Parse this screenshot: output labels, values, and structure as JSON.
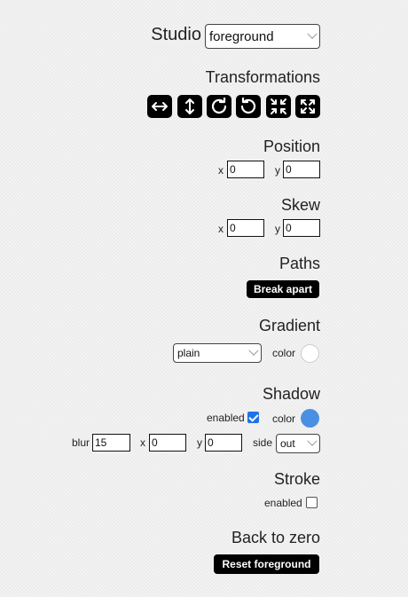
{
  "studio": {
    "title": "Studio",
    "layer_value": "foreground",
    "layer_options": [
      "foreground"
    ]
  },
  "transformations": {
    "title": "Transformations",
    "tools": [
      {
        "name": "flip-horizontal",
        "icon": "arrows-horizontal-icon"
      },
      {
        "name": "flip-vertical",
        "icon": "arrows-vertical-icon"
      },
      {
        "name": "rotate-clockwise",
        "icon": "rotate-cw-icon"
      },
      {
        "name": "rotate-counterclockwise",
        "icon": "rotate-ccw-icon"
      },
      {
        "name": "shrink",
        "icon": "collapse-icon"
      },
      {
        "name": "expand",
        "icon": "expand-icon"
      }
    ]
  },
  "position": {
    "title": "Position",
    "x_label": "x",
    "x_value": "0",
    "y_label": "y",
    "y_value": "0"
  },
  "skew": {
    "title": "Skew",
    "x_label": "x",
    "x_value": "0",
    "y_label": "y",
    "y_value": "0"
  },
  "paths": {
    "title": "Paths",
    "button_label": "Break apart"
  },
  "gradient": {
    "title": "Gradient",
    "type_value": "plain",
    "color_label": "color",
    "color": "#ffffff"
  },
  "shadow": {
    "title": "Shadow",
    "enabled_label": "enabled",
    "enabled": true,
    "color_label": "color",
    "color": "#4a90e2",
    "blur_label": "blur",
    "blur_value": "15",
    "x_label": "x",
    "x_value": "0",
    "y_label": "y",
    "y_value": "0",
    "side_label": "side",
    "side_value": "out"
  },
  "stroke": {
    "title": "Stroke",
    "enabled_label": "enabled",
    "enabled": false
  },
  "reset": {
    "title": "Back to zero",
    "button_label": "Reset foreground"
  }
}
